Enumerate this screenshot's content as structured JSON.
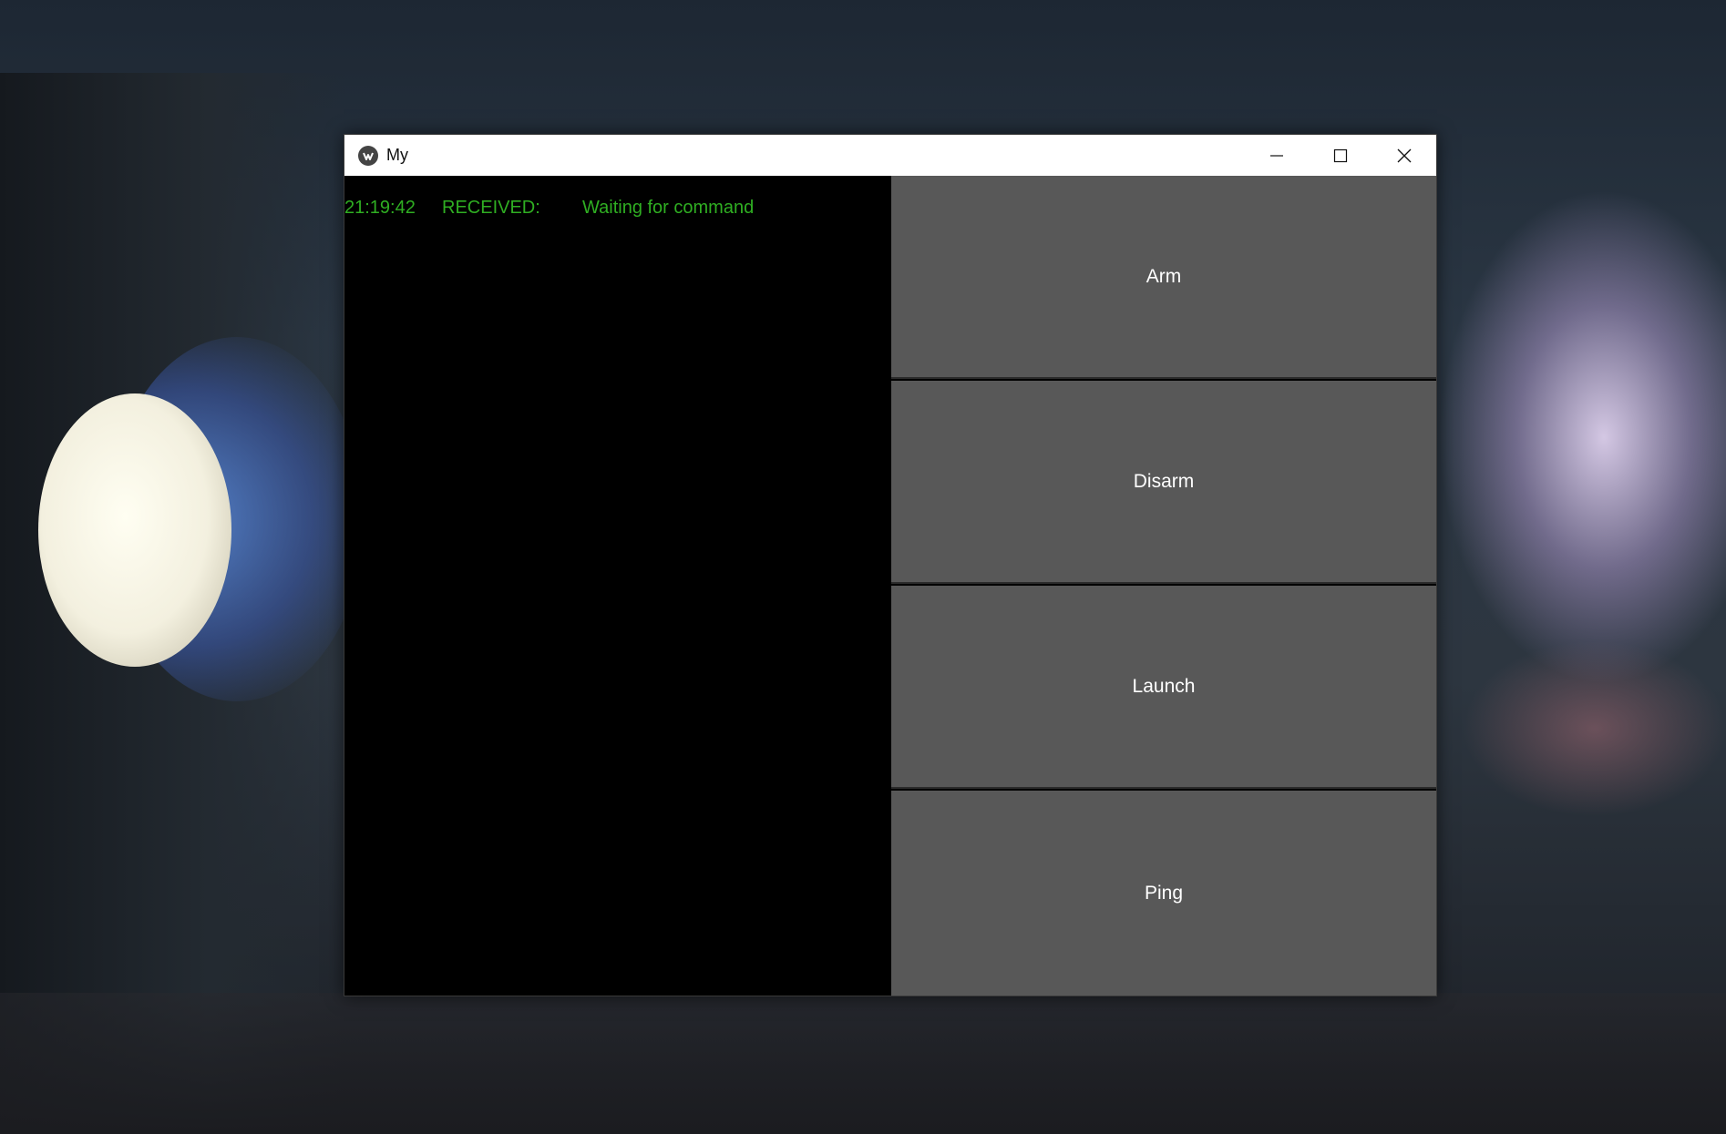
{
  "window": {
    "title": "My",
    "controls": {
      "minimize_icon": "minimize-icon",
      "maximize_icon": "maximize-icon",
      "close_icon": "close-icon"
    }
  },
  "console": {
    "lines": [
      {
        "time": "21:19:42",
        "kind": "RECEIVED:",
        "message": "Waiting for command"
      }
    ],
    "text_color": "#2fae22",
    "background": "#000000"
  },
  "commands": {
    "arm_label": "Arm",
    "disarm_label": "Disarm",
    "launch_label": "Launch",
    "ping_label": "Ping",
    "button_color": "#585858"
  }
}
